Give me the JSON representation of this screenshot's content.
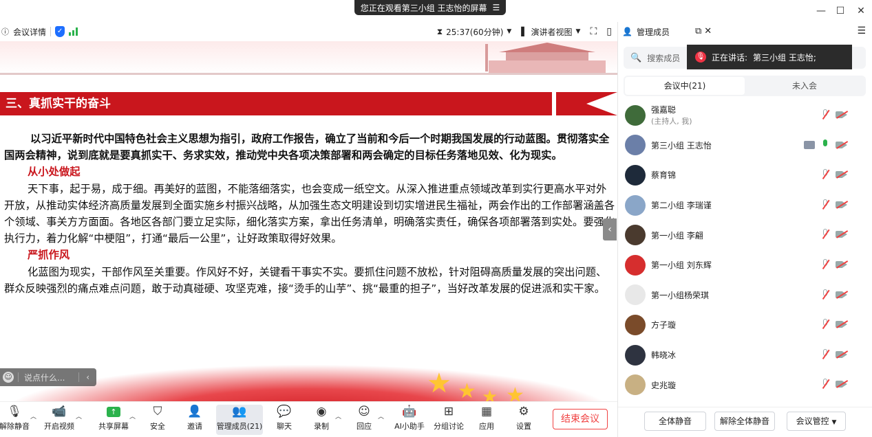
{
  "window": {
    "share_banner": "您正在观看第三小组 王志怡的屏幕",
    "banner_menu_icon": "menu-icon",
    "minimize": "—",
    "maximize": "☐",
    "close": "✕"
  },
  "infobar": {
    "meeting_details": "会议详情",
    "timer": "25:37(60分钟)",
    "view_mode": "演讲者视图"
  },
  "slide": {
    "section_title": "三、真抓实干的奋斗",
    "intro": "以习近平新时代中国特色社会主义思想为指引，政府工作报告，确立了当前和今后一个时期我国发展的行动蓝图。贯彻落实全国两会精神，说到底就是要真抓实干、务求实效，推动党中央各项决策部署和两会确定的目标任务落地见效、化为现实。",
    "heading1": "从小处做起",
    "para1": "天下事，起于易，成于细。再美好的蓝图，不能落细落实，也会变成一纸空文。从深入推进重点领域改革到实行更高水平对外开放，从推动实体经济高质量发展到全面实施乡村振兴战略，从加强生态文明建设到切实增进民生福祉，两会作出的工作部署涵盖各个领域、事关方方面面。各地区各部门要立足实际，细化落实方案，拿出任务清单，明确落实责任，确保各项部署落到实处。要强化执行力，着力化解“中梗阻”，打通“最后一公里”，让好政策取得好效果。",
    "heading2": "严抓作风",
    "para2": "化蓝图为现实，干部作风至关重要。作风好不好，关键看干事实不实。要抓住问题不放松，针对阻碍高质量发展的突出问题、群众反映强烈的痛点难点问题，敢于动真碰硬、攻坚克难，接“烫手的山芋”、挑“最重的担子”，当好改革发展的促进派和实干家。"
  },
  "chat": {
    "placeholder": "说点什么..."
  },
  "toolbar": {
    "items": [
      {
        "label": "解除静音",
        "icon": "mic-off-icon"
      },
      {
        "label": "开启视频",
        "icon": "camera-off-icon"
      },
      {
        "label": "共享屏幕",
        "icon": "share-screen-icon"
      },
      {
        "label": "安全",
        "icon": "shield-icon"
      },
      {
        "label": "邀请",
        "icon": "invite-icon"
      },
      {
        "label": "管理成员(21)",
        "icon": "members-icon"
      },
      {
        "label": "聊天",
        "icon": "chat-icon"
      },
      {
        "label": "录制",
        "icon": "record-icon"
      },
      {
        "label": "回应",
        "icon": "reaction-icon"
      },
      {
        "label": "AI小助手",
        "icon": "ai-assistant-icon"
      },
      {
        "label": "分组讨论",
        "icon": "breakout-icon"
      },
      {
        "label": "应用",
        "icon": "apps-icon"
      },
      {
        "label": "设置",
        "icon": "gear-icon"
      }
    ],
    "end_meeting": "结束会议"
  },
  "panel": {
    "title": "管理成员",
    "search_placeholder": "搜索成员",
    "speaking_label": "正在讲话:",
    "speaking_name": "第三小组 王志怡;",
    "tab_in_meeting": "会议中(21)",
    "tab_not_joined": "未入会",
    "members": [
      {
        "name": "强嘉聪",
        "sub": "(主持人, 我)",
        "mic": "off",
        "cam": "off",
        "screen": false,
        "color": "#3f6b3a"
      },
      {
        "name": "第三小组 王志怡",
        "sub": "",
        "mic": "on",
        "cam": "off",
        "screen": true,
        "color": "#6b7fa8"
      },
      {
        "name": "蔡育锦",
        "sub": "",
        "mic": "off",
        "cam": "off",
        "screen": false,
        "color": "#1e2a3a"
      },
      {
        "name": "第二小组 李瑞谨",
        "sub": "",
        "mic": "off",
        "cam": "off",
        "screen": false,
        "color": "#8aa6c8"
      },
      {
        "name": "第一小组 李翩",
        "sub": "",
        "mic": "off",
        "cam": "off",
        "screen": false,
        "color": "#4a3a2e"
      },
      {
        "name": "第一小组 刘东辉",
        "sub": "",
        "mic": "off",
        "cam": "off",
        "screen": false,
        "color": "#d62e2e"
      },
      {
        "name": "第一小组杨荣琪",
        "sub": "",
        "mic": "off",
        "cam": "off",
        "screen": false,
        "color": "#e8e8e8"
      },
      {
        "name": "方子璇",
        "sub": "",
        "mic": "off",
        "cam": "off",
        "screen": false,
        "color": "#7a4b2a"
      },
      {
        "name": "韩晓冰",
        "sub": "",
        "mic": "off",
        "cam": "off",
        "screen": false,
        "color": "#2e3340"
      },
      {
        "name": "史兆璇",
        "sub": "",
        "mic": "off",
        "cam": "off",
        "screen": false,
        "color": "#c8b083"
      }
    ],
    "mute_all": "全体静音",
    "unmute_all": "解除全体静音",
    "meeting_control": "会议管控"
  }
}
